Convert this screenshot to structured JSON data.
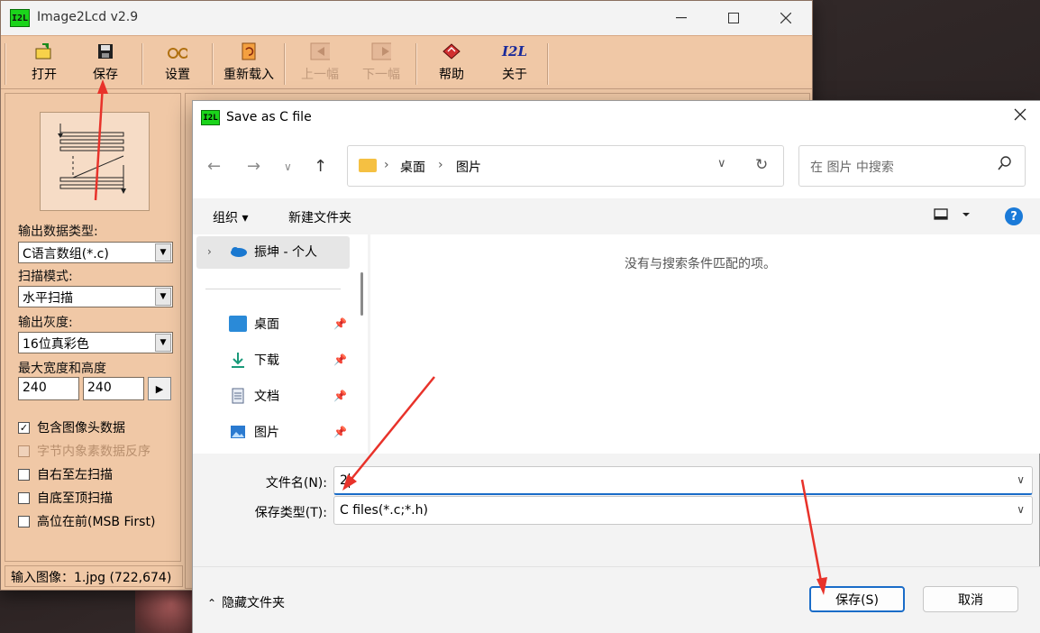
{
  "app": {
    "title": "Image2Lcd v2.9",
    "logo_text": "I2L",
    "toolbar": [
      {
        "label": "打开",
        "icon": "open-icon",
        "enabled": true
      },
      {
        "label": "保存",
        "icon": "save-icon",
        "enabled": true
      },
      {
        "label": "设置",
        "icon": "settings-icon",
        "enabled": true
      },
      {
        "label": "重新载入",
        "icon": "reload-icon",
        "enabled": true
      },
      {
        "label": "上一幅",
        "icon": "prev-icon",
        "enabled": false
      },
      {
        "label": "下一幅",
        "icon": "next-icon",
        "enabled": false
      },
      {
        "label": "帮助",
        "icon": "help-book-icon",
        "enabled": true
      },
      {
        "label": "关于",
        "icon": "about-icon",
        "enabled": true
      }
    ],
    "about_icon_text": "I2L",
    "output_type_label": "输出数据类型:",
    "output_type_value": "C语言数组(*.c)",
    "scan_mode_label": "扫描模式:",
    "scan_mode_value": "水平扫描",
    "gray_label": "输出灰度:",
    "gray_value": "16位真彩色",
    "max_size_label": "最大宽度和高度",
    "max_width": "240",
    "max_height": "240",
    "checkboxes": [
      {
        "label": "包含图像头数据",
        "checked": true,
        "enabled": true
      },
      {
        "label": "字节内象素数据反序",
        "checked": false,
        "enabled": false
      },
      {
        "label": "自右至左扫描",
        "checked": false,
        "enabled": true
      },
      {
        "label": "自底至顶扫描",
        "checked": false,
        "enabled": true
      },
      {
        "label": "高位在前(MSB First)",
        "checked": false,
        "enabled": true
      }
    ],
    "status": "输入图像：1.jpg (722,674)"
  },
  "dialog": {
    "title": "Save as C file",
    "logo_text": "I2L",
    "breadcrumbs": [
      "桌面",
      "图片"
    ],
    "search_placeholder": "在 图片 中搜索",
    "organize_label": "组织 ▾",
    "new_folder_label": "新建文件夹",
    "nav_items": [
      {
        "label": "振坤 - 个人",
        "icon": "onedrive-icon"
      },
      {
        "label": "桌面",
        "icon": "desktop-folder-icon",
        "pinned": true
      },
      {
        "label": "下载",
        "icon": "download-icon",
        "pinned": true
      },
      {
        "label": "文档",
        "icon": "documents-icon",
        "pinned": true
      },
      {
        "label": "图片",
        "icon": "pictures-icon",
        "pinned": true
      }
    ],
    "empty_message": "没有与搜索条件匹配的项。",
    "filename_label": "文件名(N):",
    "filename_value": "2",
    "filetype_label": "保存类型(T):",
    "filetype_value": "C files(*.c;*.h)",
    "hide_folders_label": "隐藏文件夹",
    "save_button": "保存(S)",
    "cancel_button": "取消"
  },
  "colors": {
    "app_bg": "#f0c8a6",
    "accent_blue": "#1a6cc8",
    "annotation_red": "#e8322a"
  }
}
